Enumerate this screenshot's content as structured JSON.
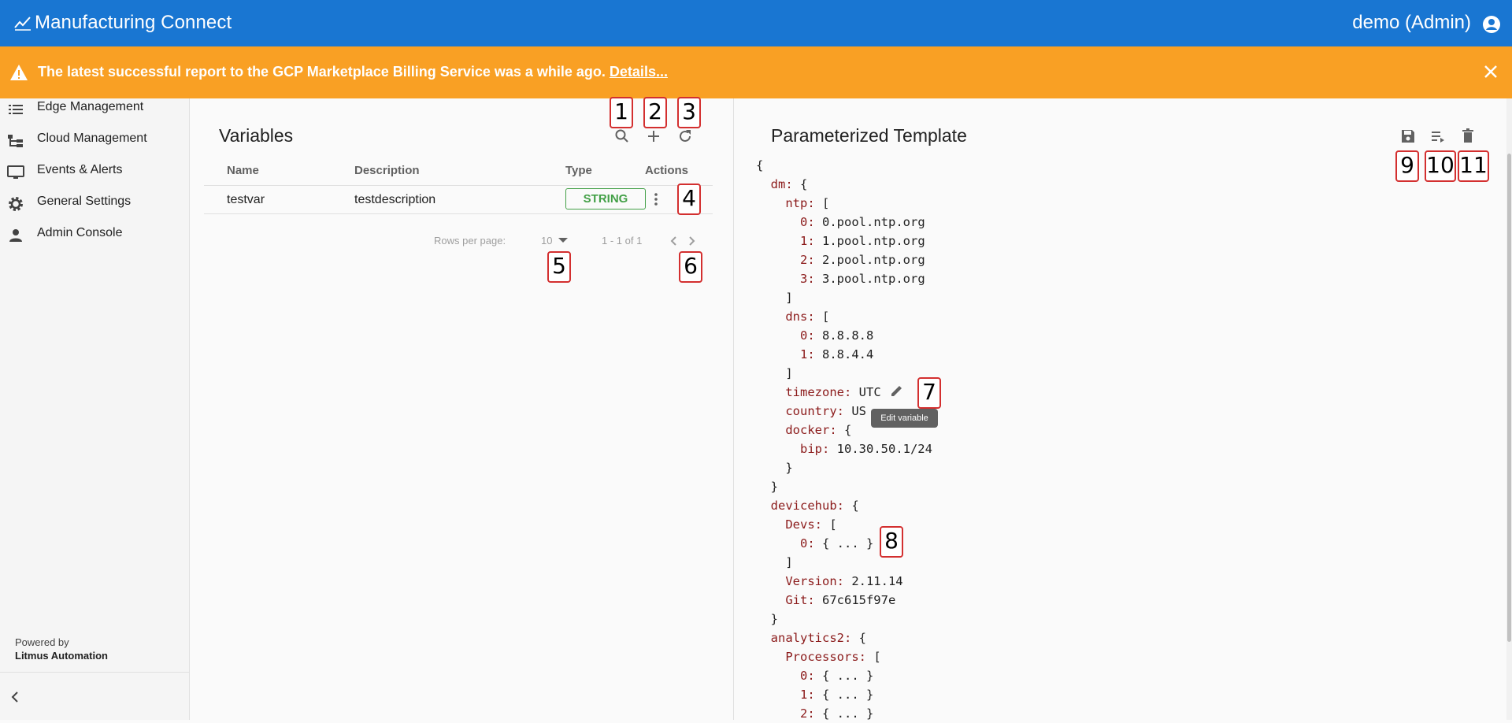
{
  "header": {
    "app_title": "Manufacturing Connect",
    "user_label": "demo (Admin)"
  },
  "banner": {
    "message": "The latest successful report to the GCP Marketplace Billing Service was a while ago.",
    "link_text": "Details..."
  },
  "sidebar": {
    "items": [
      {
        "label": "Edge Management",
        "icon": "list-icon"
      },
      {
        "label": "Cloud Management",
        "icon": "hierarchy-icon"
      },
      {
        "label": "Events & Alerts",
        "icon": "monitor-icon"
      },
      {
        "label": "General Settings",
        "icon": "gear-icon"
      },
      {
        "label": "Admin Console",
        "icon": "person-icon"
      }
    ],
    "powered_by": "Powered by",
    "powered_by_company": "Litmus Automation"
  },
  "variables": {
    "title": "Variables",
    "columns": {
      "name": "Name",
      "description": "Description",
      "type": "Type",
      "actions": "Actions"
    },
    "rows": [
      {
        "name": "testvar",
        "description": "testdescription",
        "type": "STRING"
      }
    ],
    "pagination": {
      "rows_per_page_label": "Rows per page:",
      "rows_per_page": "10",
      "range": "1 - 1 of 1"
    }
  },
  "template": {
    "title": "Parameterized Template",
    "tooltip": "Edit variable",
    "lines": [
      {
        "indent": "",
        "key": "",
        "value": "{"
      },
      {
        "indent": "  ",
        "key": "dm:",
        "value": " {"
      },
      {
        "indent": "    ",
        "key": "ntp:",
        "value": " ["
      },
      {
        "indent": "      ",
        "key": "0:",
        "value": " 0.pool.ntp.org"
      },
      {
        "indent": "      ",
        "key": "1:",
        "value": " 1.pool.ntp.org"
      },
      {
        "indent": "      ",
        "key": "2:",
        "value": " 2.pool.ntp.org"
      },
      {
        "indent": "      ",
        "key": "3:",
        "value": " 3.pool.ntp.org"
      },
      {
        "indent": "    ",
        "key": "",
        "value": "]"
      },
      {
        "indent": "    ",
        "key": "dns:",
        "value": " ["
      },
      {
        "indent": "      ",
        "key": "0:",
        "value": " 8.8.8.8"
      },
      {
        "indent": "      ",
        "key": "1:",
        "value": " 8.8.4.4"
      },
      {
        "indent": "    ",
        "key": "",
        "value": "]"
      },
      {
        "indent": "    ",
        "key": "timezone:",
        "value": " UTC"
      },
      {
        "indent": "    ",
        "key": "country:",
        "value": " US"
      },
      {
        "indent": "    ",
        "key": "docker:",
        "value": " {"
      },
      {
        "indent": "      ",
        "key": "bip:",
        "value": " 10.30.50.1/24"
      },
      {
        "indent": "    ",
        "key": "",
        "value": "}"
      },
      {
        "indent": "  ",
        "key": "",
        "value": "}"
      },
      {
        "indent": "  ",
        "key": "devicehub:",
        "value": " {"
      },
      {
        "indent": "    ",
        "key": "Devs:",
        "value": " ["
      },
      {
        "indent": "      ",
        "key": "0:",
        "value": " { ... }"
      },
      {
        "indent": "    ",
        "key": "",
        "value": "]"
      },
      {
        "indent": "    ",
        "key": "Version:",
        "value": " 2.11.14"
      },
      {
        "indent": "    ",
        "key": "Git:",
        "value": " 67c615f97e"
      },
      {
        "indent": "  ",
        "key": "",
        "value": "}"
      },
      {
        "indent": "  ",
        "key": "analytics2:",
        "value": " {"
      },
      {
        "indent": "    ",
        "key": "Processors:",
        "value": " ["
      },
      {
        "indent": "      ",
        "key": "0:",
        "value": " { ... }"
      },
      {
        "indent": "      ",
        "key": "1:",
        "value": " { ... }"
      },
      {
        "indent": "      ",
        "key": "2:",
        "value": " { ... }"
      }
    ]
  },
  "callouts": [
    "1",
    "2",
    "3",
    "4",
    "5",
    "6",
    "7",
    "8",
    "9",
    "10",
    "11"
  ],
  "colors": {
    "header": "#1976d2",
    "banner": "#f9a024",
    "chip": "#43a047",
    "json_key": "#8b1a1a"
  }
}
